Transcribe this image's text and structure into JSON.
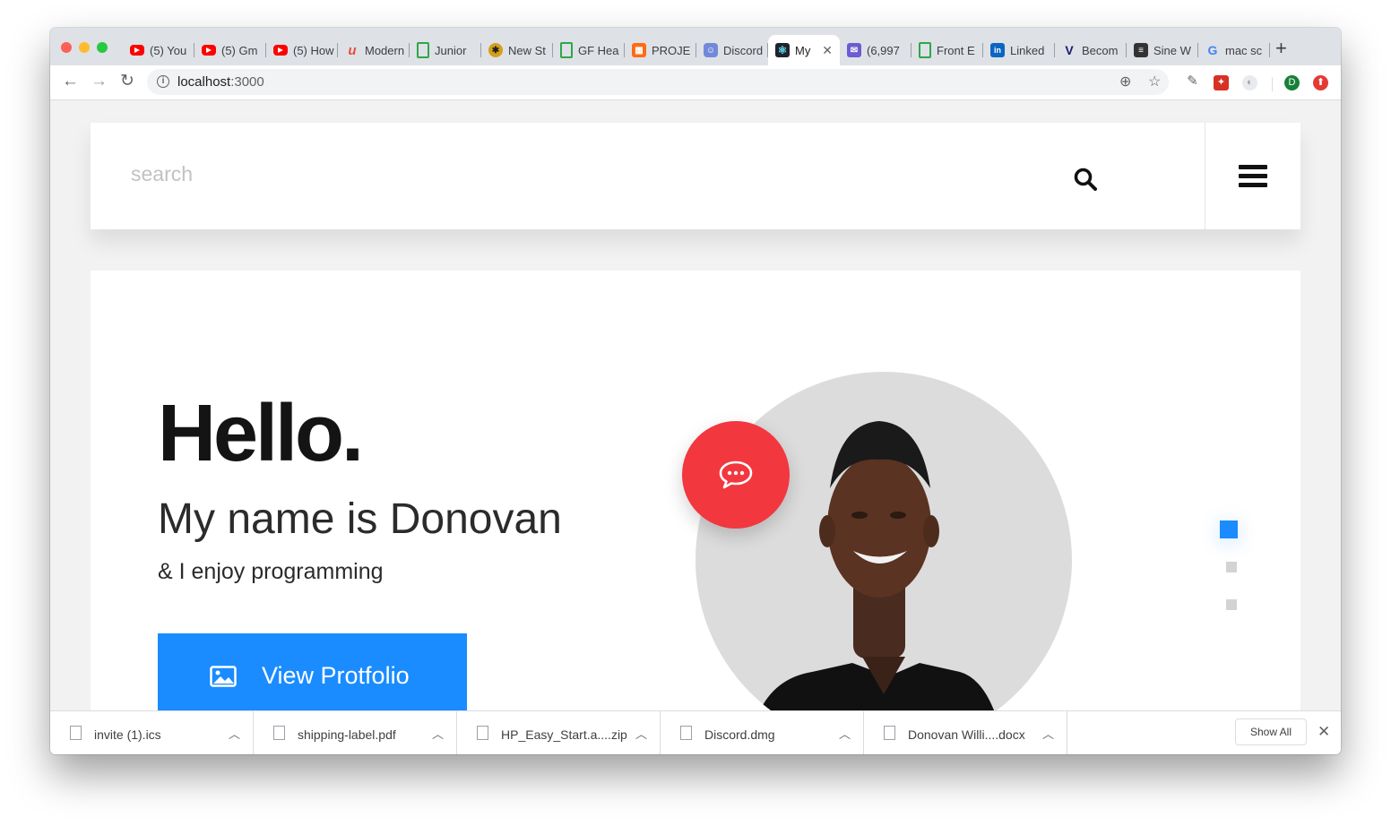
{
  "browser": {
    "tabs": [
      {
        "title": "(5) You",
        "favicon": "youtube-icon"
      },
      {
        "title": "(5) Gm",
        "favicon": "youtube-icon"
      },
      {
        "title": "(5) How",
        "favicon": "youtube-icon"
      },
      {
        "title": "Modern",
        "favicon": "udemy-icon"
      },
      {
        "title": "Junior",
        "favicon": "greenhouse-icon"
      },
      {
        "title": "New St",
        "favicon": "general-assembly-icon"
      },
      {
        "title": "GF Hea",
        "favicon": "greenhouse-icon"
      },
      {
        "title": "PROJE",
        "favicon": "project-icon"
      },
      {
        "title": "Discord",
        "favicon": "discord-icon"
      },
      {
        "title": "My",
        "favicon": "react-icon",
        "active": true
      },
      {
        "title": "(6,997",
        "favicon": "mail-icon"
      },
      {
        "title": "Front E",
        "favicon": "greenhouse-icon"
      },
      {
        "title": "Linked",
        "favicon": "linkedin-icon"
      },
      {
        "title": "Becom",
        "favicon": "v-icon"
      },
      {
        "title": "Sine W",
        "favicon": "document-icon"
      },
      {
        "title": "mac sc",
        "favicon": "google-icon"
      }
    ],
    "new_tab_label": "+",
    "url_host": "localhost",
    "url_port": ":3000",
    "profile_initial": "D"
  },
  "page": {
    "search_placeholder": "search",
    "hero": {
      "heading": "Hello.",
      "name_line": "My name is Donovan",
      "tagline": "& I enjoy programming",
      "cta_label": "View Protfolio"
    },
    "slides": {
      "count": 3,
      "active": 1
    },
    "accent_color": "#1a8cff",
    "chat_color": "#f2373f"
  },
  "downloads": {
    "items": [
      {
        "name": "invite (1).ics"
      },
      {
        "name": "shipping-label.pdf"
      },
      {
        "name": "HP_Easy_Start.a....zip"
      },
      {
        "name": "Discord.dmg"
      },
      {
        "name": "Donovan Willi....docx"
      }
    ],
    "show_all_label": "Show All"
  }
}
